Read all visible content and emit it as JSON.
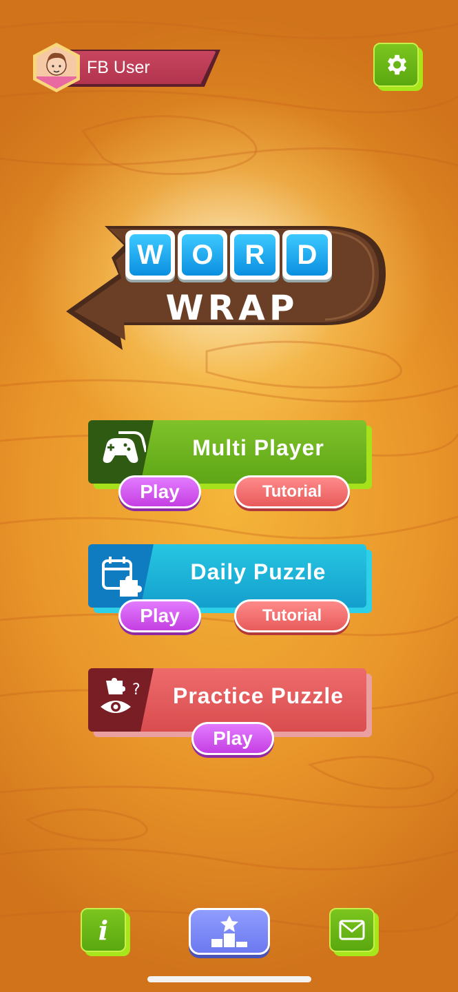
{
  "profile": {
    "username": "FB User",
    "avatar_icon": "user-avatar"
  },
  "header": {
    "settings_icon": "gear-icon"
  },
  "logo": {
    "tiles": [
      "W",
      "O",
      "R",
      "D"
    ],
    "subtitle": "WRAP"
  },
  "modes": [
    {
      "title": "Multi Player",
      "icon": "gamepad-icon",
      "play_label": "Play",
      "tutorial_label": "Tutorial",
      "color": "#6db51e"
    },
    {
      "title": "Daily Puzzle",
      "icon": "calendar-puzzle-icon",
      "play_label": "Play",
      "tutorial_label": "Tutorial",
      "color": "#1fb7d8"
    },
    {
      "title": "Practice Puzzle",
      "icon": "puzzle-eye-icon",
      "play_label": "Play",
      "color": "#e35a5a"
    }
  ],
  "bottom_bar": {
    "info_icon": "info-icon",
    "leaderboard_icon": "leaderboard-icon",
    "mail_icon": "mail-icon"
  }
}
